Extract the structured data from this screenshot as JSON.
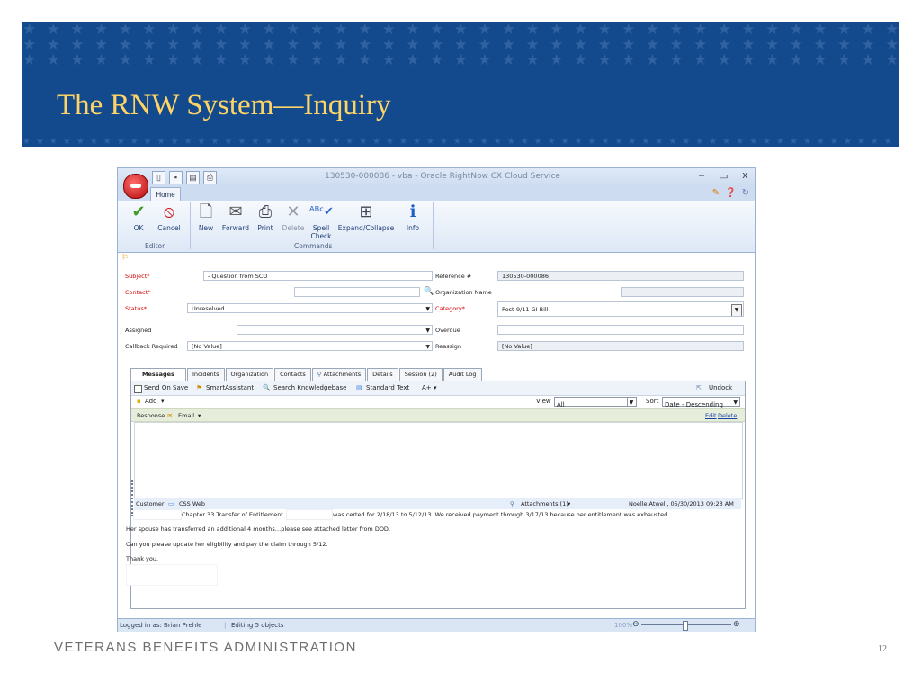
{
  "slide": {
    "title": "The RNW System—Inquiry",
    "footer": "VETERANS BENEFITS ADMINISTRATION",
    "page_number": "12",
    "banner_color": "#134a8d",
    "title_color": "#ffd466"
  },
  "window": {
    "title": "130530-000086 - vba - Oracle RightNow CX Cloud Service",
    "tab": "Home",
    "minimize": "–",
    "maximize": "▭",
    "close": "x"
  },
  "ribbon": {
    "buttons": {
      "ok": "OK",
      "cancel": "Cancel",
      "new": "New",
      "forward": "Forward",
      "print": "Print",
      "delete": "Delete",
      "spell_check": "Spell Check",
      "expand_collapse": "Expand/Collapse",
      "info": "Info"
    },
    "groups": {
      "editor": "Editor",
      "commands": "Commands"
    }
  },
  "form": {
    "subject_label": "Subject*",
    "subject_value": "- Question from SCO",
    "contact_label": "Contact*",
    "contact_value": "",
    "status_label": "Status*",
    "status_value": "Unresolved",
    "assigned_label": "Assigned",
    "assigned_value": "",
    "callback_label": "Callback Required",
    "callback_value": "[No Value]",
    "reference_label": "Reference #",
    "reference_value": "130530-000086",
    "org_label": "Organization Name",
    "org_value": "",
    "category_label": "Category*",
    "category_value": "Post-9/11 GI Bill",
    "overdue_label": "Overdue",
    "overdue_value": "",
    "reassign_label": "Reassign",
    "reassign_value": "[No Value]"
  },
  "tabs": [
    "Messages",
    "Incidents",
    "Organization",
    "Contacts",
    "Attachments",
    "Details",
    "Session (2)",
    "Audit Log"
  ],
  "messages": {
    "send_on_save": "Send On Save",
    "smart_assistant": "SmartAssistant",
    "search_kb": "Search Knowledgebase",
    "standard_text": "Standard Text",
    "font_menu": "A+",
    "undock": "Undock",
    "add": "Add",
    "view_label": "View",
    "view_value": "All",
    "sort_label": "Sort",
    "sort_value": "Date - Descending",
    "response_label": "Response",
    "email_label": "Email",
    "edit_link": "Edit",
    "delete_link": "Delete"
  },
  "thread": {
    "customer_label": "Customer",
    "channel": "CSS Web",
    "attachments": "Attachments (1)",
    "author_date": "Noelle Atwell, 05/30/2013 09:23 AM",
    "line1_a": "Chapter 33 Transfer of Entitlement",
    "line1_b": "was certed for 2/18/13 to 5/12/13. We received payment through 3/17/13 because her entitlement was exhausted.",
    "line2": "Her spouse has transferred an additional 4 months…please see attached letter from DOD.",
    "line3": "Can you please update her eligbility and pay the claim through 5/12.",
    "line4": "Thank you."
  },
  "status_bar": {
    "logged_in": "Logged in as: Brian Prehle",
    "editing": "Editing 5 objects",
    "zoom": "100%"
  }
}
